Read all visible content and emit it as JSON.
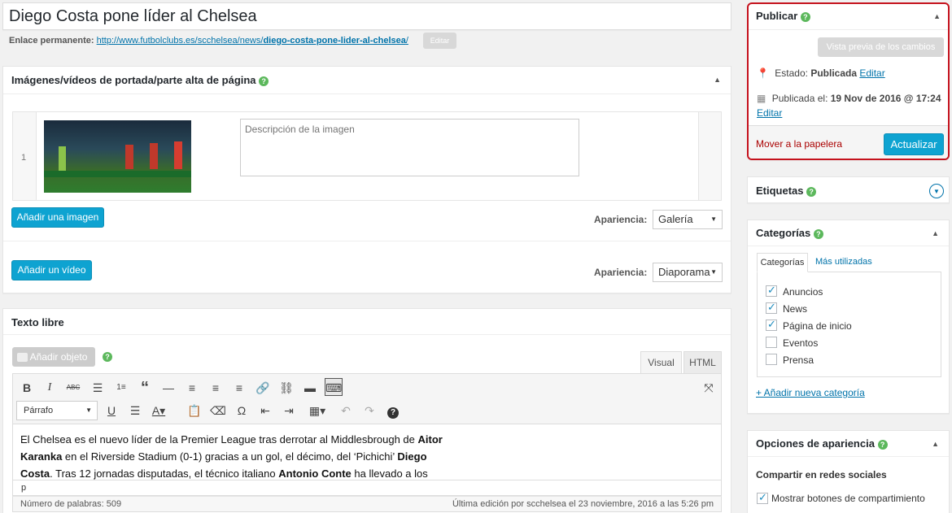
{
  "post": {
    "title": "Diego Costa pone líder al Chelsea",
    "permalink_label": "Enlace permanente:",
    "permalink_base": "http://www.futbolclubs.es/scchelsea/news/",
    "permalink_slug": "diego-costa-pone-lider-al-chelsea",
    "permalink_end": "/",
    "edit_label": "Editar"
  },
  "media_box": {
    "title": "Imágenes/vídeos de portada/parte alta de página",
    "row_index": "1",
    "description_placeholder": "Descripción de la imagen",
    "add_image": "Añadir una imagen",
    "add_video": "Añadir un vídeo",
    "appearance_label": "Apariencia:",
    "image_appearance": "Galería",
    "video_appearance": "Diaporama"
  },
  "editor": {
    "title": "Texto libre",
    "add_object": "Añadir objeto",
    "tab_visual": "Visual",
    "tab_html": "HTML",
    "format_select": "Párrafo",
    "content": {
      "p1": "El Chelsea es el nuevo líder de la Premier League tras derrotar al Middlesbrough de ",
      "b1": "Aitor",
      "b1b": "Karanka",
      "p2": " en el Riverside Stadium (0-1) gracias a un gol, el décimo, del ‘Pichichi’ ",
      "b2": "Diego",
      "b2b": "Costa",
      "p3": ". Tras 12 jornadas disputadas, el técnico italiano ",
      "b3": "Antonio Conte",
      "p4": " ha llevado a los"
    },
    "path": "p",
    "word_count": "Número de palabras: 509",
    "last_edit": "Última edición por scchelsea el 23 noviembre, 2016 a las 5:26 pm"
  },
  "publish": {
    "title": "Publicar",
    "preview": "Vista previa de los cambios",
    "status_label": "Estado:",
    "status_value": "Publicada",
    "edit": "Editar",
    "published_label": "Publicada el:",
    "published_value": "19 Nov de 2016 @ 17:24",
    "trash": "Mover a la papelera",
    "update": "Actualizar"
  },
  "tags_box": {
    "title": "Etiquetas"
  },
  "categories_box": {
    "title": "Categorías",
    "tab_all": "Categorías",
    "tab_used": "Más utilizadas",
    "items": [
      {
        "label": "Anuncios",
        "checked": true
      },
      {
        "label": "News",
        "checked": true
      },
      {
        "label": "Página de inicio",
        "checked": true
      },
      {
        "label": "Eventos",
        "checked": false
      },
      {
        "label": "Prensa",
        "checked": false
      }
    ],
    "add_new": "+ Añadir nueva categoría"
  },
  "appearance_box": {
    "title": "Opciones de apariencia",
    "share_heading": "Compartir en redes sociales",
    "share_option": "Mostrar botones de compartimiento"
  },
  "colors": {
    "accent": "#0ea3d1",
    "highlight": "#c5121d",
    "help": "#5cb85c",
    "trash": "#a00"
  }
}
